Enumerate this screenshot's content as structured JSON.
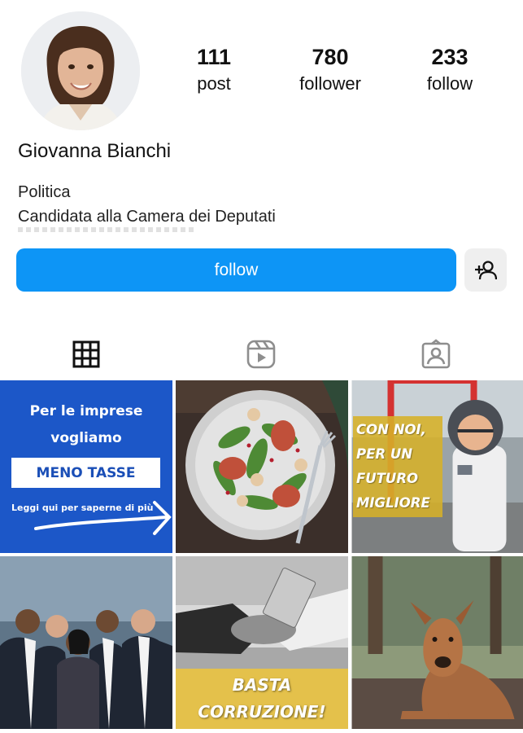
{
  "profile": {
    "name": "Giovanna Bianchi",
    "bio": [
      "Politica",
      "Candidata alla Camera dei Deputati"
    ]
  },
  "stats": {
    "posts": {
      "value": "111",
      "label": "post"
    },
    "followers": {
      "value": "780",
      "label": "follower"
    },
    "following": {
      "value": "233",
      "label": "follow"
    }
  },
  "actions": {
    "follow_label": "follow",
    "suggest_icon": "person-add-icon"
  },
  "tabs": [
    {
      "icon": "grid-icon",
      "active": true
    },
    {
      "icon": "reels-icon",
      "active": false
    },
    {
      "icon": "tagged-icon",
      "active": false
    }
  ],
  "posts": [
    {
      "lines": [
        "Per le imprese",
        "vogliamo"
      ],
      "highlight": "MENO TASSE",
      "caption": "Leggi qui per saperne di più",
      "bg": "#1c57c8"
    },
    {
      "subject": "salad-plate"
    },
    {
      "lines": [
        "CON NOI,",
        "PER UN",
        "FUTURO",
        "MIGLIORE"
      ],
      "bg": "#d6b028"
    },
    {
      "subject": "business-team"
    },
    {
      "lines": [
        "BASTA",
        "CORRUZIONE!"
      ],
      "bg": "#e4c14b"
    },
    {
      "subject": "dog"
    }
  ],
  "colors": {
    "accent": "#0d95f6",
    "secondary_button": "#efefef",
    "icon": "#111111",
    "icon_inactive": "#8e8e8e"
  }
}
